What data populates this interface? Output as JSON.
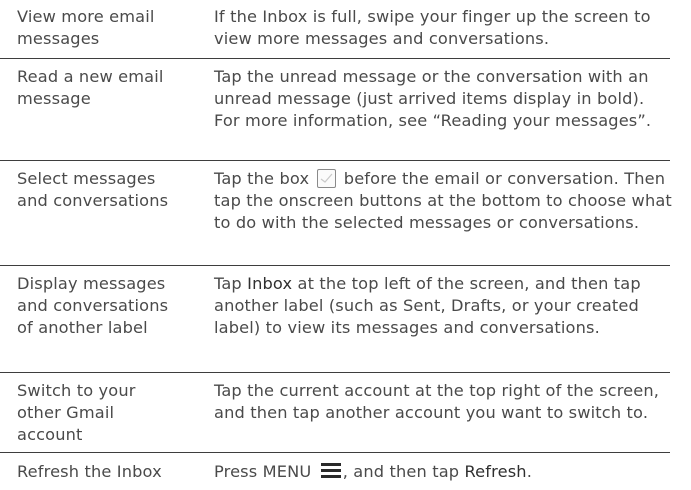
{
  "rows": [
    {
      "action": "View more email\nmessages",
      "description": "If the Inbox is full, swipe your finger up the screen to view more messages and conversations."
    },
    {
      "action": "Read a new email\nmessage",
      "description": "Tap the unread message or the conversation with an unread message (just arrived items display in bold). For more information, see “Reading your messages”."
    },
    {
      "action": "Select messages\nand conversations",
      "desc_before_icon": "Tap the box",
      "desc_icon": "checkbox-icon",
      "desc_after_icon": " before the email or conversation. Then tap the onscreen buttons at the bottom to choose what to do with the selected messages or conversations."
    },
    {
      "action": "Display messages\nand conversations\nof another label",
      "desc_before_kw": "Tap ",
      "desc_kw": "Inbox",
      "desc_after_kw": " at the top left of the screen, and then tap another label (such as Sent, Drafts, or your created label) to view its messages and conversations."
    },
    {
      "action": "Switch to your\nother Gmail\naccount",
      "description": "Tap the current account at the top right of the screen, and then tap another account you want to switch to."
    },
    {
      "action": "Refresh the Inbox",
      "desc_before_icon": "Press MENU",
      "desc_icon": "menu-icon",
      "desc_middle": ", and then tap ",
      "desc_kw": "Refresh",
      "desc_end": "."
    }
  ]
}
